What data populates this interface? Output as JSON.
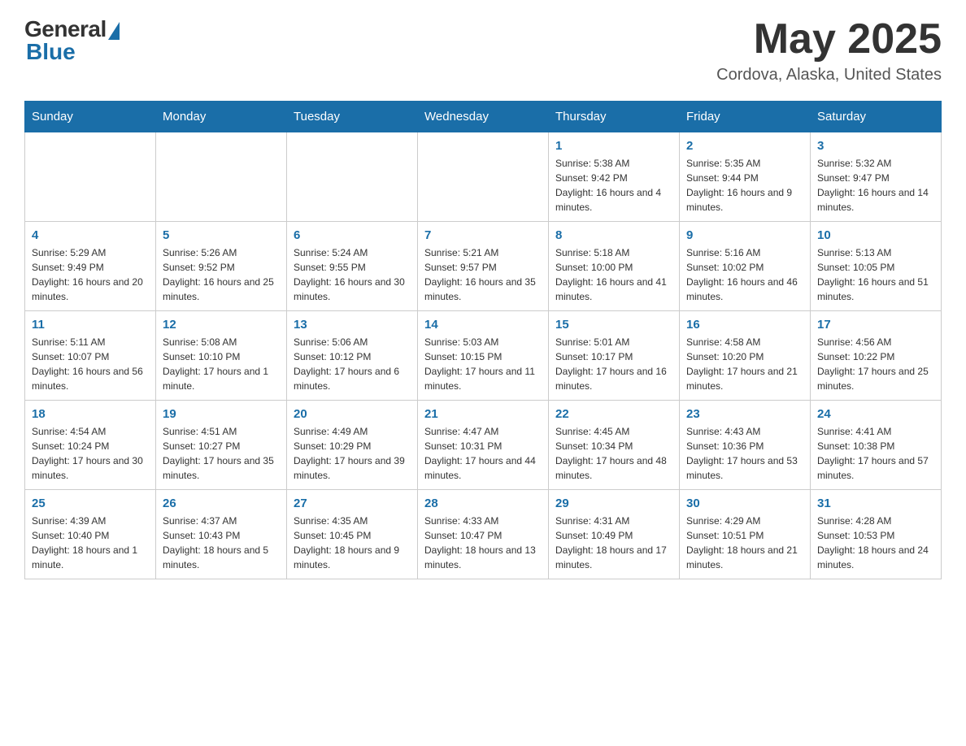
{
  "header": {
    "logo_general": "General",
    "logo_blue": "Blue",
    "month_title": "May 2025",
    "location": "Cordova, Alaska, United States"
  },
  "days_of_week": [
    "Sunday",
    "Monday",
    "Tuesday",
    "Wednesday",
    "Thursday",
    "Friday",
    "Saturday"
  ],
  "weeks": [
    {
      "days": [
        {
          "number": "",
          "info": ""
        },
        {
          "number": "",
          "info": ""
        },
        {
          "number": "",
          "info": ""
        },
        {
          "number": "",
          "info": ""
        },
        {
          "number": "1",
          "info": "Sunrise: 5:38 AM\nSunset: 9:42 PM\nDaylight: 16 hours and 4 minutes."
        },
        {
          "number": "2",
          "info": "Sunrise: 5:35 AM\nSunset: 9:44 PM\nDaylight: 16 hours and 9 minutes."
        },
        {
          "number": "3",
          "info": "Sunrise: 5:32 AM\nSunset: 9:47 PM\nDaylight: 16 hours and 14 minutes."
        }
      ]
    },
    {
      "days": [
        {
          "number": "4",
          "info": "Sunrise: 5:29 AM\nSunset: 9:49 PM\nDaylight: 16 hours and 20 minutes."
        },
        {
          "number": "5",
          "info": "Sunrise: 5:26 AM\nSunset: 9:52 PM\nDaylight: 16 hours and 25 minutes."
        },
        {
          "number": "6",
          "info": "Sunrise: 5:24 AM\nSunset: 9:55 PM\nDaylight: 16 hours and 30 minutes."
        },
        {
          "number": "7",
          "info": "Sunrise: 5:21 AM\nSunset: 9:57 PM\nDaylight: 16 hours and 35 minutes."
        },
        {
          "number": "8",
          "info": "Sunrise: 5:18 AM\nSunset: 10:00 PM\nDaylight: 16 hours and 41 minutes."
        },
        {
          "number": "9",
          "info": "Sunrise: 5:16 AM\nSunset: 10:02 PM\nDaylight: 16 hours and 46 minutes."
        },
        {
          "number": "10",
          "info": "Sunrise: 5:13 AM\nSunset: 10:05 PM\nDaylight: 16 hours and 51 minutes."
        }
      ]
    },
    {
      "days": [
        {
          "number": "11",
          "info": "Sunrise: 5:11 AM\nSunset: 10:07 PM\nDaylight: 16 hours and 56 minutes."
        },
        {
          "number": "12",
          "info": "Sunrise: 5:08 AM\nSunset: 10:10 PM\nDaylight: 17 hours and 1 minute."
        },
        {
          "number": "13",
          "info": "Sunrise: 5:06 AM\nSunset: 10:12 PM\nDaylight: 17 hours and 6 minutes."
        },
        {
          "number": "14",
          "info": "Sunrise: 5:03 AM\nSunset: 10:15 PM\nDaylight: 17 hours and 11 minutes."
        },
        {
          "number": "15",
          "info": "Sunrise: 5:01 AM\nSunset: 10:17 PM\nDaylight: 17 hours and 16 minutes."
        },
        {
          "number": "16",
          "info": "Sunrise: 4:58 AM\nSunset: 10:20 PM\nDaylight: 17 hours and 21 minutes."
        },
        {
          "number": "17",
          "info": "Sunrise: 4:56 AM\nSunset: 10:22 PM\nDaylight: 17 hours and 25 minutes."
        }
      ]
    },
    {
      "days": [
        {
          "number": "18",
          "info": "Sunrise: 4:54 AM\nSunset: 10:24 PM\nDaylight: 17 hours and 30 minutes."
        },
        {
          "number": "19",
          "info": "Sunrise: 4:51 AM\nSunset: 10:27 PM\nDaylight: 17 hours and 35 minutes."
        },
        {
          "number": "20",
          "info": "Sunrise: 4:49 AM\nSunset: 10:29 PM\nDaylight: 17 hours and 39 minutes."
        },
        {
          "number": "21",
          "info": "Sunrise: 4:47 AM\nSunset: 10:31 PM\nDaylight: 17 hours and 44 minutes."
        },
        {
          "number": "22",
          "info": "Sunrise: 4:45 AM\nSunset: 10:34 PM\nDaylight: 17 hours and 48 minutes."
        },
        {
          "number": "23",
          "info": "Sunrise: 4:43 AM\nSunset: 10:36 PM\nDaylight: 17 hours and 53 minutes."
        },
        {
          "number": "24",
          "info": "Sunrise: 4:41 AM\nSunset: 10:38 PM\nDaylight: 17 hours and 57 minutes."
        }
      ]
    },
    {
      "days": [
        {
          "number": "25",
          "info": "Sunrise: 4:39 AM\nSunset: 10:40 PM\nDaylight: 18 hours and 1 minute."
        },
        {
          "number": "26",
          "info": "Sunrise: 4:37 AM\nSunset: 10:43 PM\nDaylight: 18 hours and 5 minutes."
        },
        {
          "number": "27",
          "info": "Sunrise: 4:35 AM\nSunset: 10:45 PM\nDaylight: 18 hours and 9 minutes."
        },
        {
          "number": "28",
          "info": "Sunrise: 4:33 AM\nSunset: 10:47 PM\nDaylight: 18 hours and 13 minutes."
        },
        {
          "number": "29",
          "info": "Sunrise: 4:31 AM\nSunset: 10:49 PM\nDaylight: 18 hours and 17 minutes."
        },
        {
          "number": "30",
          "info": "Sunrise: 4:29 AM\nSunset: 10:51 PM\nDaylight: 18 hours and 21 minutes."
        },
        {
          "number": "31",
          "info": "Sunrise: 4:28 AM\nSunset: 10:53 PM\nDaylight: 18 hours and 24 minutes."
        }
      ]
    }
  ]
}
